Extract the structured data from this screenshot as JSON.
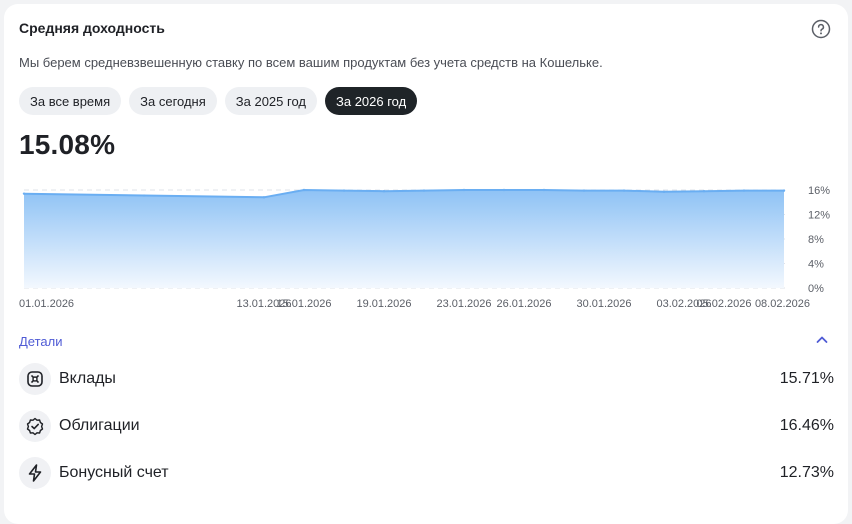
{
  "header": {
    "title": "Средняя доходность",
    "subtitle": "Мы берем средневзвешенную ставку по всем вашим продуктам без учета средств на Кошельке."
  },
  "periods": [
    {
      "label": "За все время",
      "active": false
    },
    {
      "label": "За сегодня",
      "active": false
    },
    {
      "label": "За 2025 год",
      "active": false
    },
    {
      "label": "За 2026 год",
      "active": true
    }
  ],
  "summary": {
    "value": "15.08%"
  },
  "chart_data": {
    "type": "area",
    "x": [
      "01.01.2026",
      "07.01.2026",
      "13.01.2026",
      "15.01.2026",
      "17.01.2026",
      "19.01.2026",
      "21.01.2026",
      "23.01.2026",
      "25.01.2026",
      "27.01.2026",
      "29.01.2026",
      "31.01.2026",
      "02.02.2026",
      "04.02.2026",
      "06.02.2026",
      "08.02.2026"
    ],
    "y": [
      15.4,
      15.1,
      14.8,
      16.0,
      15.9,
      15.8,
      15.9,
      16.0,
      16.0,
      16.0,
      15.9,
      15.9,
      15.7,
      15.8,
      15.9,
      15.9
    ],
    "ylim": [
      0,
      16
    ],
    "yticks": [
      "16%",
      "12%",
      "8%",
      "4%",
      "0%"
    ],
    "xticks": [
      "01.01.2026",
      "13.01.2026",
      "15.01.2026",
      "19.01.2026",
      "23.01.2026",
      "26.01.2026",
      "30.01.2026",
      "03.02.2026",
      "05.02.2026",
      "08.02.2026"
    ],
    "grid": true,
    "line_color": "#6aaef2",
    "fill_top": "#8ec2f5",
    "fill_bottom": "#f3f8fe"
  },
  "details": {
    "label": "Детали",
    "items": [
      {
        "label": "Вклады",
        "value": "15.71%",
        "icon": "deposit-icon"
      },
      {
        "label": "Облигации",
        "value": "16.46%",
        "icon": "bonds-icon"
      },
      {
        "label": "Бонусный счет",
        "value": "12.73%",
        "icon": "lightning-icon"
      }
    ]
  },
  "colors": {
    "accent": "#4f5bd5",
    "active_chip": "#1f2428"
  }
}
